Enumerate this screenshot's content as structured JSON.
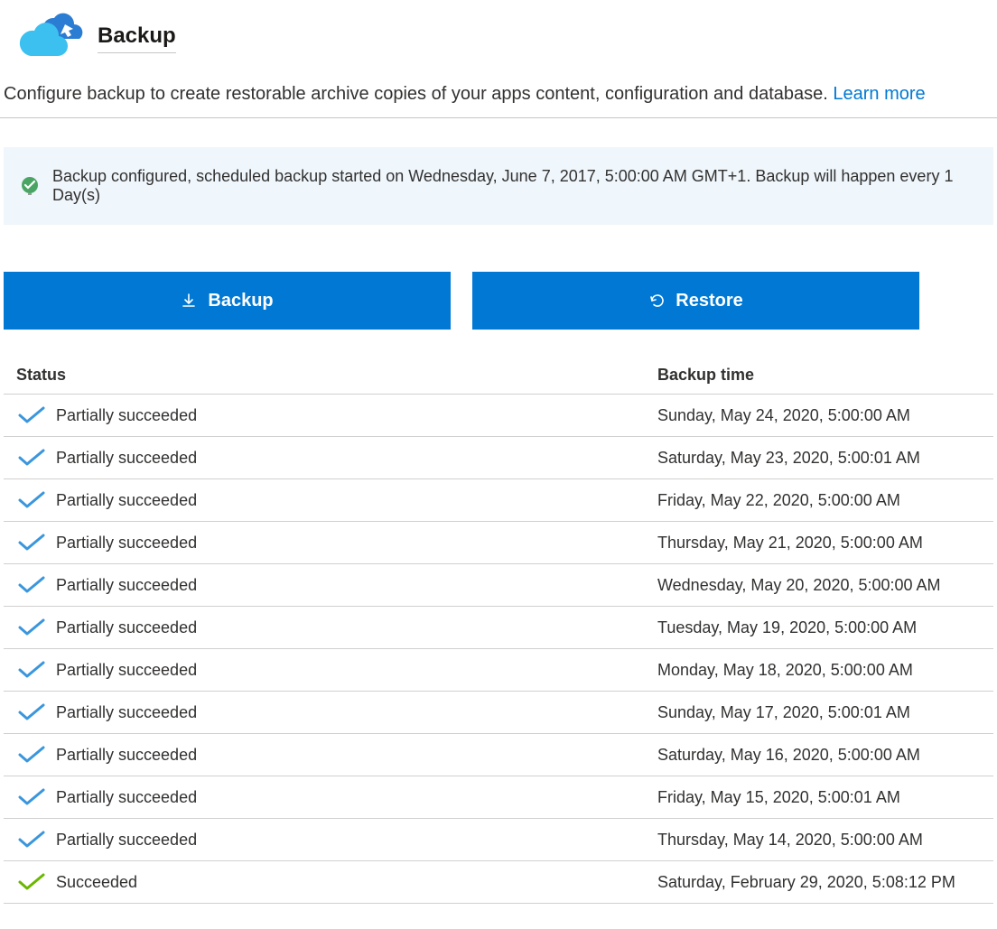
{
  "header": {
    "title": "Backup"
  },
  "description": {
    "text": "Configure backup to create restorable archive copies of your apps content, configuration and database. ",
    "link_text": "Learn more"
  },
  "banner": {
    "text": "Backup configured, scheduled backup started on Wednesday, June 7, 2017, 5:00:00 AM GMT+1. Backup will happen every 1 Day(s)"
  },
  "buttons": {
    "backup_label": "Backup",
    "restore_label": "Restore"
  },
  "table": {
    "columns": {
      "status": "Status",
      "time": "Backup time"
    },
    "rows": [
      {
        "status": "Partially succeeded",
        "status_kind": "partial",
        "time": "Sunday, May 24, 2020, 5:00:00 AM"
      },
      {
        "status": "Partially succeeded",
        "status_kind": "partial",
        "time": "Saturday, May 23, 2020, 5:00:01 AM"
      },
      {
        "status": "Partially succeeded",
        "status_kind": "partial",
        "time": "Friday, May 22, 2020, 5:00:00 AM"
      },
      {
        "status": "Partially succeeded",
        "status_kind": "partial",
        "time": "Thursday, May 21, 2020, 5:00:00 AM"
      },
      {
        "status": "Partially succeeded",
        "status_kind": "partial",
        "time": "Wednesday, May 20, 2020, 5:00:00 AM"
      },
      {
        "status": "Partially succeeded",
        "status_kind": "partial",
        "time": "Tuesday, May 19, 2020, 5:00:00 AM"
      },
      {
        "status": "Partially succeeded",
        "status_kind": "partial",
        "time": "Monday, May 18, 2020, 5:00:00 AM"
      },
      {
        "status": "Partially succeeded",
        "status_kind": "partial",
        "time": "Sunday, May 17, 2020, 5:00:01 AM"
      },
      {
        "status": "Partially succeeded",
        "status_kind": "partial",
        "time": "Saturday, May 16, 2020, 5:00:00 AM"
      },
      {
        "status": "Partially succeeded",
        "status_kind": "partial",
        "time": "Friday, May 15, 2020, 5:00:01 AM"
      },
      {
        "status": "Partially succeeded",
        "status_kind": "partial",
        "time": "Thursday, May 14, 2020, 5:00:00 AM"
      },
      {
        "status": "Succeeded",
        "status_kind": "success",
        "time": "Saturday, February 29, 2020, 5:08:12 PM"
      }
    ]
  },
  "colors": {
    "primary": "#0078d4",
    "partial_check": "#3a96dd",
    "success_check": "#6bb700",
    "banner_bg": "#eff6fc"
  }
}
